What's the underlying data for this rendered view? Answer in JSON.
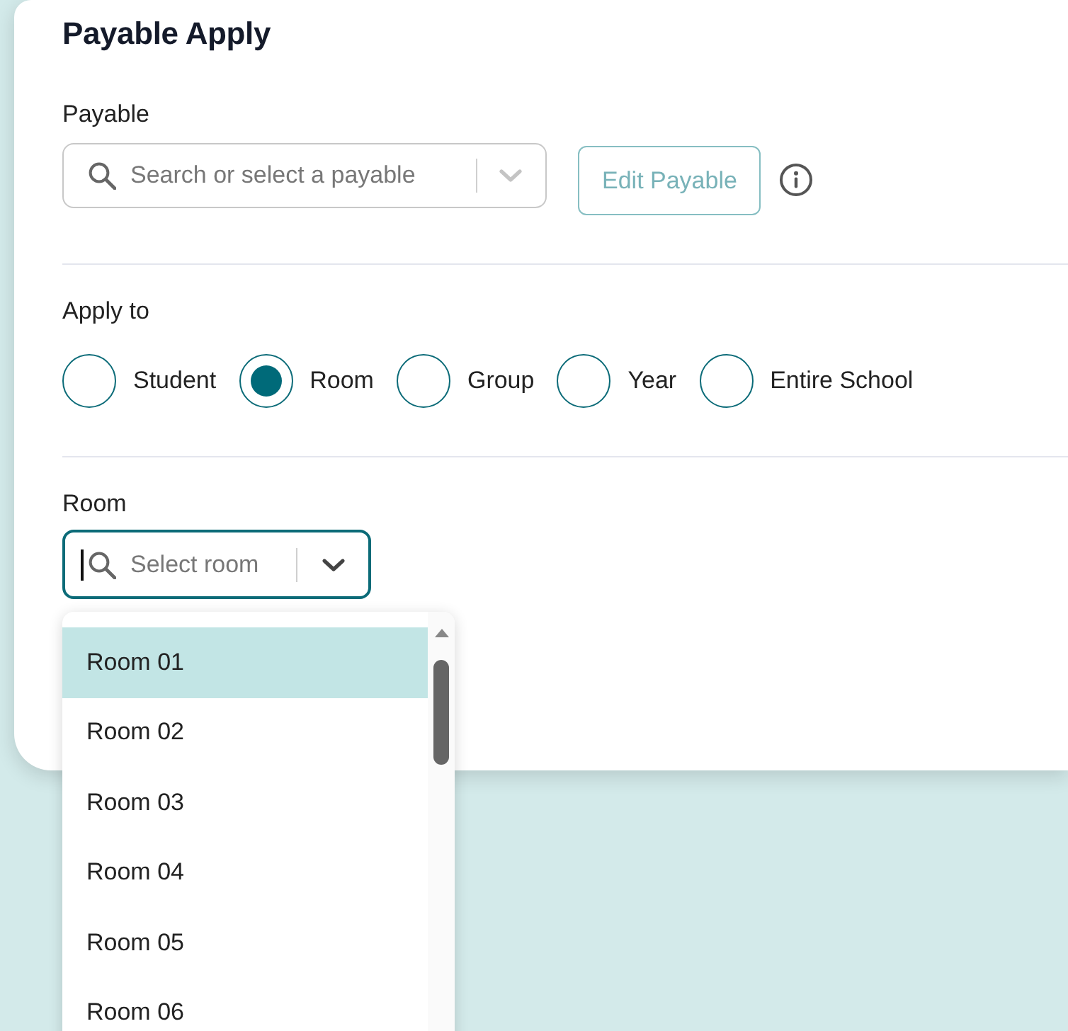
{
  "card": {
    "title": "Payable Apply"
  },
  "payable": {
    "label": "Payable",
    "placeholder": "Search or select a payable",
    "disabled": true
  },
  "edit_button": {
    "label": "Edit Payable",
    "disabled": true
  },
  "apply_to": {
    "label": "Apply to",
    "options": [
      {
        "label": "Student",
        "selected": false
      },
      {
        "label": "Room",
        "selected": true
      },
      {
        "label": "Group",
        "selected": false
      },
      {
        "label": "Year",
        "selected": false
      },
      {
        "label": "Entire School",
        "selected": false
      }
    ]
  },
  "room": {
    "label": "Room",
    "placeholder": "Select room",
    "focused": true,
    "expanded": true,
    "options": [
      {
        "label": "Room 01",
        "highlighted": true
      },
      {
        "label": "Room 02",
        "highlighted": false
      },
      {
        "label": "Room 03",
        "highlighted": false
      },
      {
        "label": "Room 04",
        "highlighted": false
      },
      {
        "label": "Room 05",
        "highlighted": false
      },
      {
        "label": "Room 06",
        "highlighted": false
      }
    ]
  }
}
